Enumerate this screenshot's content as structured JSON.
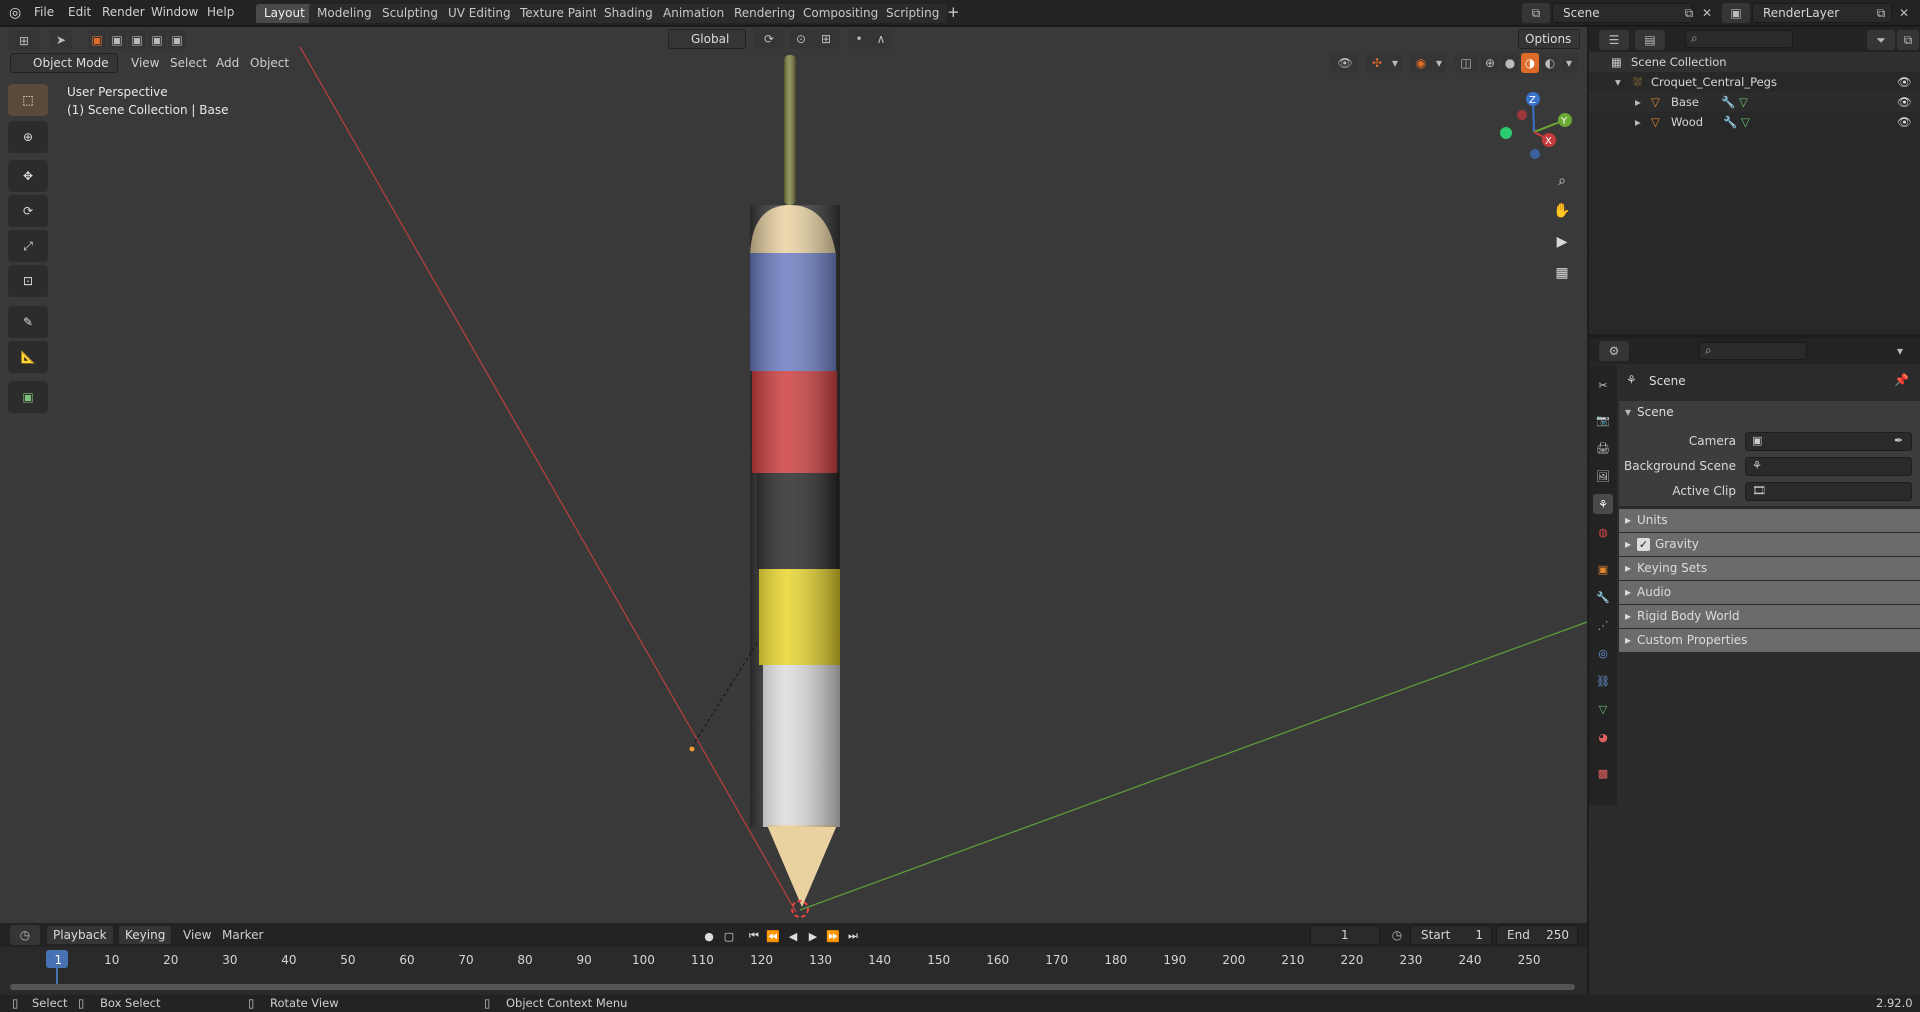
{
  "menu": {
    "items": [
      "File",
      "Edit",
      "Render",
      "Window",
      "Help"
    ]
  },
  "workspaces": {
    "tabs": [
      "Layout",
      "Modeling",
      "Sculpting",
      "UV Editing",
      "Texture Paint",
      "Shading",
      "Animation",
      "Rendering",
      "Compositing",
      "Scripting"
    ],
    "active": "Layout",
    "add_label": "+"
  },
  "scene_selector": {
    "value": "Scene"
  },
  "viewlayer_selector": {
    "value": "RenderLayer"
  },
  "header_tools": {
    "transform_orientation": "Global",
    "options_label": "Options"
  },
  "viewport_header": {
    "mode": "Object Mode",
    "menus": [
      "View",
      "Select",
      "Add",
      "Object"
    ]
  },
  "viewport": {
    "perspective_label": "User Perspective",
    "collection_label": "(1) Scene Collection | Base"
  },
  "gizmo": {
    "x_label": "X",
    "y_label": "Y",
    "z_label": "Z"
  },
  "outliner": {
    "root": "Scene Collection",
    "collection": "Croquet_Central_Pegs",
    "objects": [
      "Base",
      "Wood"
    ]
  },
  "properties": {
    "context_title": "Scene",
    "panel_title": "Scene",
    "fields": [
      {
        "label": "Camera"
      },
      {
        "label": "Background Scene"
      },
      {
        "label": "Active Clip"
      }
    ],
    "subpanels": [
      "Units",
      "Gravity",
      "Keying Sets",
      "Audio",
      "Rigid Body World",
      "Custom Properties"
    ],
    "gravity_checked": true
  },
  "timeline": {
    "menus": [
      "Playback",
      "Keying",
      "View",
      "Marker"
    ],
    "current_frame": "1",
    "start_label": "Start",
    "start_value": "1",
    "end_label": "End",
    "end_value": "250",
    "ruler": [
      "1",
      "10",
      "20",
      "30",
      "40",
      "50",
      "60",
      "70",
      "80",
      "90",
      "100",
      "110",
      "120",
      "130",
      "140",
      "150",
      "160",
      "170",
      "180",
      "190",
      "200",
      "210",
      "220",
      "230",
      "240",
      "250"
    ]
  },
  "statusbar": {
    "select": "Select",
    "box_select": "Box Select",
    "rotate_view": "Rotate View",
    "context_menu": "Object Context Menu",
    "version": "2.92.0"
  },
  "colors": {
    "accent": "#4772b3",
    "active_tool": "#e06a28",
    "x_axis": "#c8393b",
    "y_axis": "#6aa832",
    "z_axis": "#3a72c9",
    "stripe_blue": "#6a7bc1",
    "stripe_red": "#cc3b3b",
    "stripe_black": "#262626",
    "stripe_yellow": "#e8d429",
    "stripe_white": "#dcdcdc",
    "wood": "#e9d1a0"
  }
}
